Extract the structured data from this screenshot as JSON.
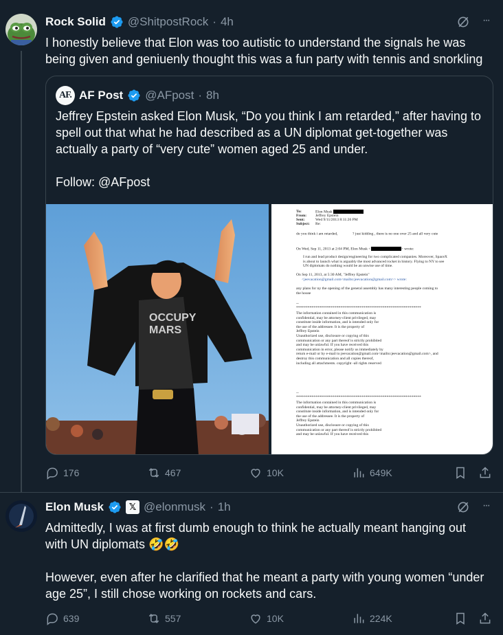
{
  "tweet1": {
    "name": "Rock Solid",
    "handle": "@ShitpostRock",
    "time": "4h",
    "text_lines": [
      "I honestly believe that Elon was too autistic to understand the signals he was",
      "being given and geniuenly thought this was a fun party with tennis and snorkling"
    ],
    "quote": {
      "logo_text": "AF.",
      "name": "AF Post",
      "handle": "@AFpost",
      "time": "8h",
      "text_lines": [
        "Jeffrey Epstein asked Elon Musk, “Do you think I am retarded,” after having to",
        "spell out that what he had described as a UN diplomat get-together was",
        "actually a party of “very cute” women aged 25 and under."
      ],
      "follow": "Follow: @AFpost",
      "document": {
        "to": "To:",
        "to_val": "Elon Musk",
        "from": "From:",
        "from_val": "Jeffrey Epstein",
        "sent": "Sent:",
        "sent_val": "Wed 9/11/2013 8:11:26 PM",
        "subject": "Subject:",
        "subject_val": "Re:",
        "line1a": "do you think i am retarded,",
        "line1b": "?",
        "line1c": "just kidding   , there is no one over 25 and all very cute",
        "wrote1a": "On Wed, Sep 11, 2013 at 2:04 PM, Elon Musk <",
        "wrote1b": "> wrote:",
        "para1": [
          "I run and lead product design/engineering for two complicated companies. Moreover, SpaceX",
          "is about to launch what is arguably the most advanced rocket in history. Flying to NY to see",
          "UN diplomats do nothing would be an unwise use of time."
        ],
        "wrote2": [
          "On Sep 11, 2013, at 5:30 AM, \"Jeffrey Epstein\"",
          "<jeevacation@gmail.com<mailto:jeevacation@gmail.com>> wrote:"
        ],
        "para2": [
          "any plans for ny     the opening of the general assembly has many interesting people coming to",
          "   the house"
        ],
        "dashes": "--",
        "stars": "*****************************************************************",
        "disclaimer1": [
          "The information contained in this communication is",
          "confidential, may be attorney-client privileged, may",
          "constitute inside information, and is intended only for",
          "the use of the addressee. It is the property of",
          "Jeffrey Epstein",
          "Unauthorized use, disclosure or copying of this",
          "communication or any part thereof is strictly prohibited",
          "and may be unlawful. If you have received this",
          "communication in error, please notify us immediately by",
          "return e-mail or by e-mail to jeevacation@gmail.com<mailto:jeevacation@gmail.com>, and",
          "destroy this communication and all copies thereof,",
          "including all attachments. copyright -all rights reserved"
        ],
        "disclaimer2": [
          "The information contained in this communication is",
          "confidential, may be attorney-client privileged, may",
          "constitute inside information, and is intended only for",
          "the use of the addressee. It is the property of",
          "Jeffrey Epstein",
          "Unauthorized use, disclosure or copying of this",
          "communication or any part thereof is strictly prohibited",
          "and may be unlawful. If you have received this"
        ]
      }
    },
    "stats": {
      "replies": "176",
      "reposts": "467",
      "likes": "10K",
      "views": "649K"
    }
  },
  "tweet2": {
    "name": "Elon Musk",
    "x_badge": "𝕏",
    "handle": "@elonmusk",
    "time": "1h",
    "text_lines": [
      "Admittedly, I was at first dumb enough to think he actually meant hanging out",
      "with UN diplomats 🤣🤣"
    ],
    "text2_lines": [
      "However, even after he clarified that he meant a party with young women “under",
      "age 25”, I still chose working on rockets and cars."
    ],
    "stats": {
      "replies": "639",
      "reposts": "557",
      "likes": "10K",
      "views": "224K"
    }
  },
  "dot": "·",
  "more": "···",
  "colors": {
    "bg": "#15202b",
    "muted": "#8b98a5",
    "verified": "#1d9bf0",
    "border": "#38444d"
  }
}
